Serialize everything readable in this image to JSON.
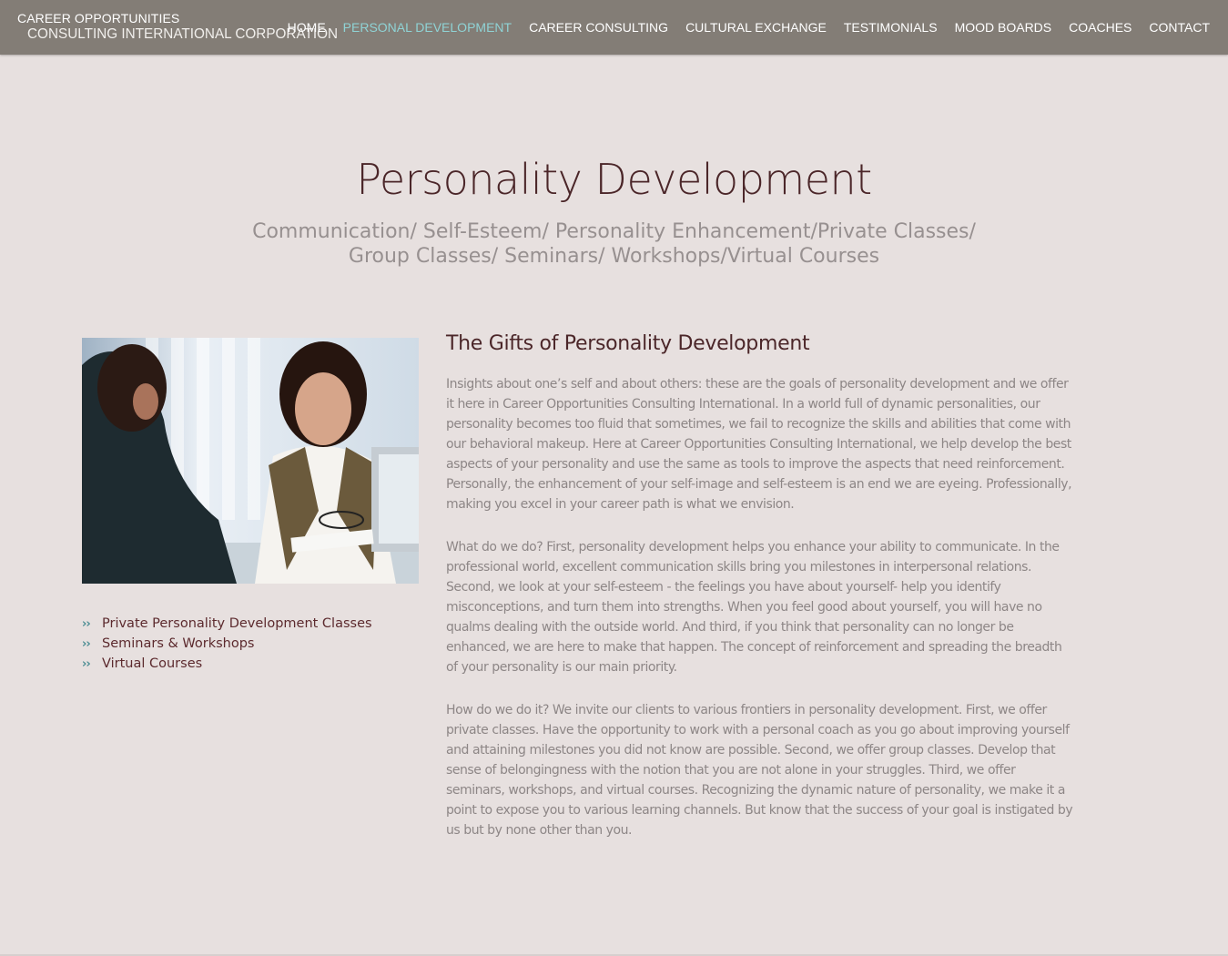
{
  "brand": {
    "line1": "CAREER OPPORTUNITIES",
    "line2": "CONSULTING INTERNATIONAL CORPORATION"
  },
  "nav": [
    {
      "label": "HOME"
    },
    {
      "label": "PERSONAL DEVELOPMENT"
    },
    {
      "label": "CAREER CONSULTING"
    },
    {
      "label": "CULTURAL EXCHANGE"
    },
    {
      "label": "TESTIMONIALS"
    },
    {
      "label": "MOOD BOARDS"
    },
    {
      "label": "COACHES"
    },
    {
      "label": "CONTACT"
    }
  ],
  "hero": {
    "title": "Personality Development",
    "subtitle_line1": "Communication/ Self-Esteem/ Personality Enhancement/Private Classes/",
    "subtitle_line2": "Group Classes/ Seminars/ Workshops/Virtual Courses"
  },
  "sidebar": {
    "links": [
      {
        "label": "Private Personality Development Classes"
      },
      {
        "label": "Seminars & Workshops"
      },
      {
        "label": "Virtual Courses"
      }
    ]
  },
  "article": {
    "heading": "The Gifts of Personality Development",
    "paragraphs": [
      "Insights about one’s self and about others: these are the goals of personality development and we offer it here in Career Opportunities Consulting International. In a world full of dynamic personalities, our personality becomes too fluid that sometimes, we fail to recognize the skills and abilities that come with our behavioral makeup. Here at Career Opportunities Consulting International, we help develop the best aspects of your personality and use the same as tools to improve the aspects that need reinforcement. Personally, the enhancement of your self-image and self-esteem is an end we are eyeing. Professionally, making you excel in your career path is what we envision.",
      "What do we do? First, personality development helps you enhance your ability to communicate. In the professional world, excellent communication skills bring you milestones in interpersonal relations. Second, we look at your self-esteem - the feelings you have about yourself- help you identify misconceptions, and turn them into strengths. When you feel good about yourself, you will have no qualms dealing with the outside world. And third, if you think that personality can no longer be enhanced, we are here to make that happen. The concept of reinforcement and spreading the breadth of your personality is our main priority.",
      "How do we do it? We invite our clients to various frontiers in personality development. First, we offer private classes. Have the opportunity to work with a personal coach as you go about improving yourself and attaining milestones you did not know are possible. Second, we offer group classes. Develop that sense of belongingness with the notion that you are not alone in your struggles. Third, we offer seminars, workshops, and virtual courses. Recognizing the dynamic nature of personality, we make it a point to expose you to various learning channels. But know that the success of your goal is instigated by us but by none other than you."
    ]
  },
  "colors": {
    "header_bg": "#837d76",
    "page_bg": "#e7e0df",
    "active_nav": "#8fd3d5",
    "heading": "#4b2629",
    "bullet": "#4b8d93"
  }
}
